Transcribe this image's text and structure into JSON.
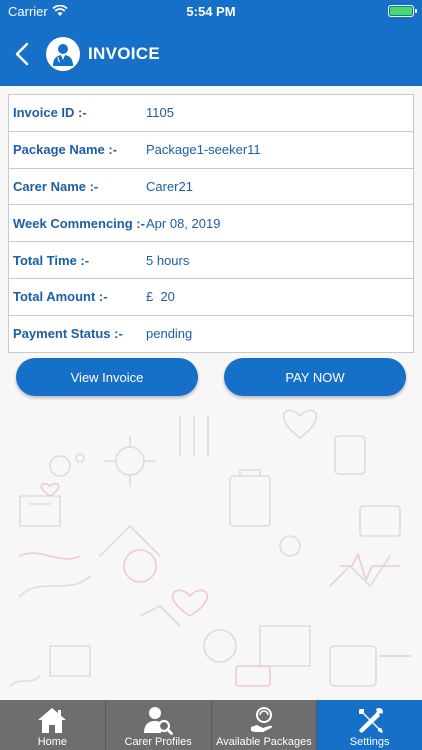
{
  "status_bar": {
    "carrier": "Carrier",
    "time": "5:54 PM"
  },
  "header": {
    "title": "INVOICE",
    "back_icon": "chevron-left-icon",
    "avatar_icon": "doctor-avatar-icon"
  },
  "invoice": {
    "rows": [
      {
        "label": "Invoice ID :-",
        "value": "1105"
      },
      {
        "label": "Package Name :-",
        "value": "Package1-seeker11"
      },
      {
        "label": "Carer Name :-",
        "value": "Carer21"
      },
      {
        "label": "Week Commencing :-",
        "value": "Apr 08, 2019"
      },
      {
        "label": "Total Time :-",
        "value": "5 hours"
      },
      {
        "label": "Total Amount :-",
        "value": "£  20"
      },
      {
        "label": "Payment Status :-",
        "value": "pending"
      }
    ]
  },
  "buttons": {
    "view_invoice": "View Invoice",
    "pay_now": "PAY NOW"
  },
  "tabs": [
    {
      "label": "Home",
      "icon": "home-icon",
      "active": false
    },
    {
      "label": "Carer Profiles",
      "icon": "profile-search-icon",
      "active": false
    },
    {
      "label": "Available Packages",
      "icon": "packages-icon",
      "active": false
    },
    {
      "label": "Settings",
      "icon": "tools-icon",
      "active": true
    }
  ],
  "colors": {
    "primary": "#1770c8",
    "text": "#1a5fa8",
    "tab_inactive": "#6e6e6e",
    "battery": "#4cd964"
  }
}
